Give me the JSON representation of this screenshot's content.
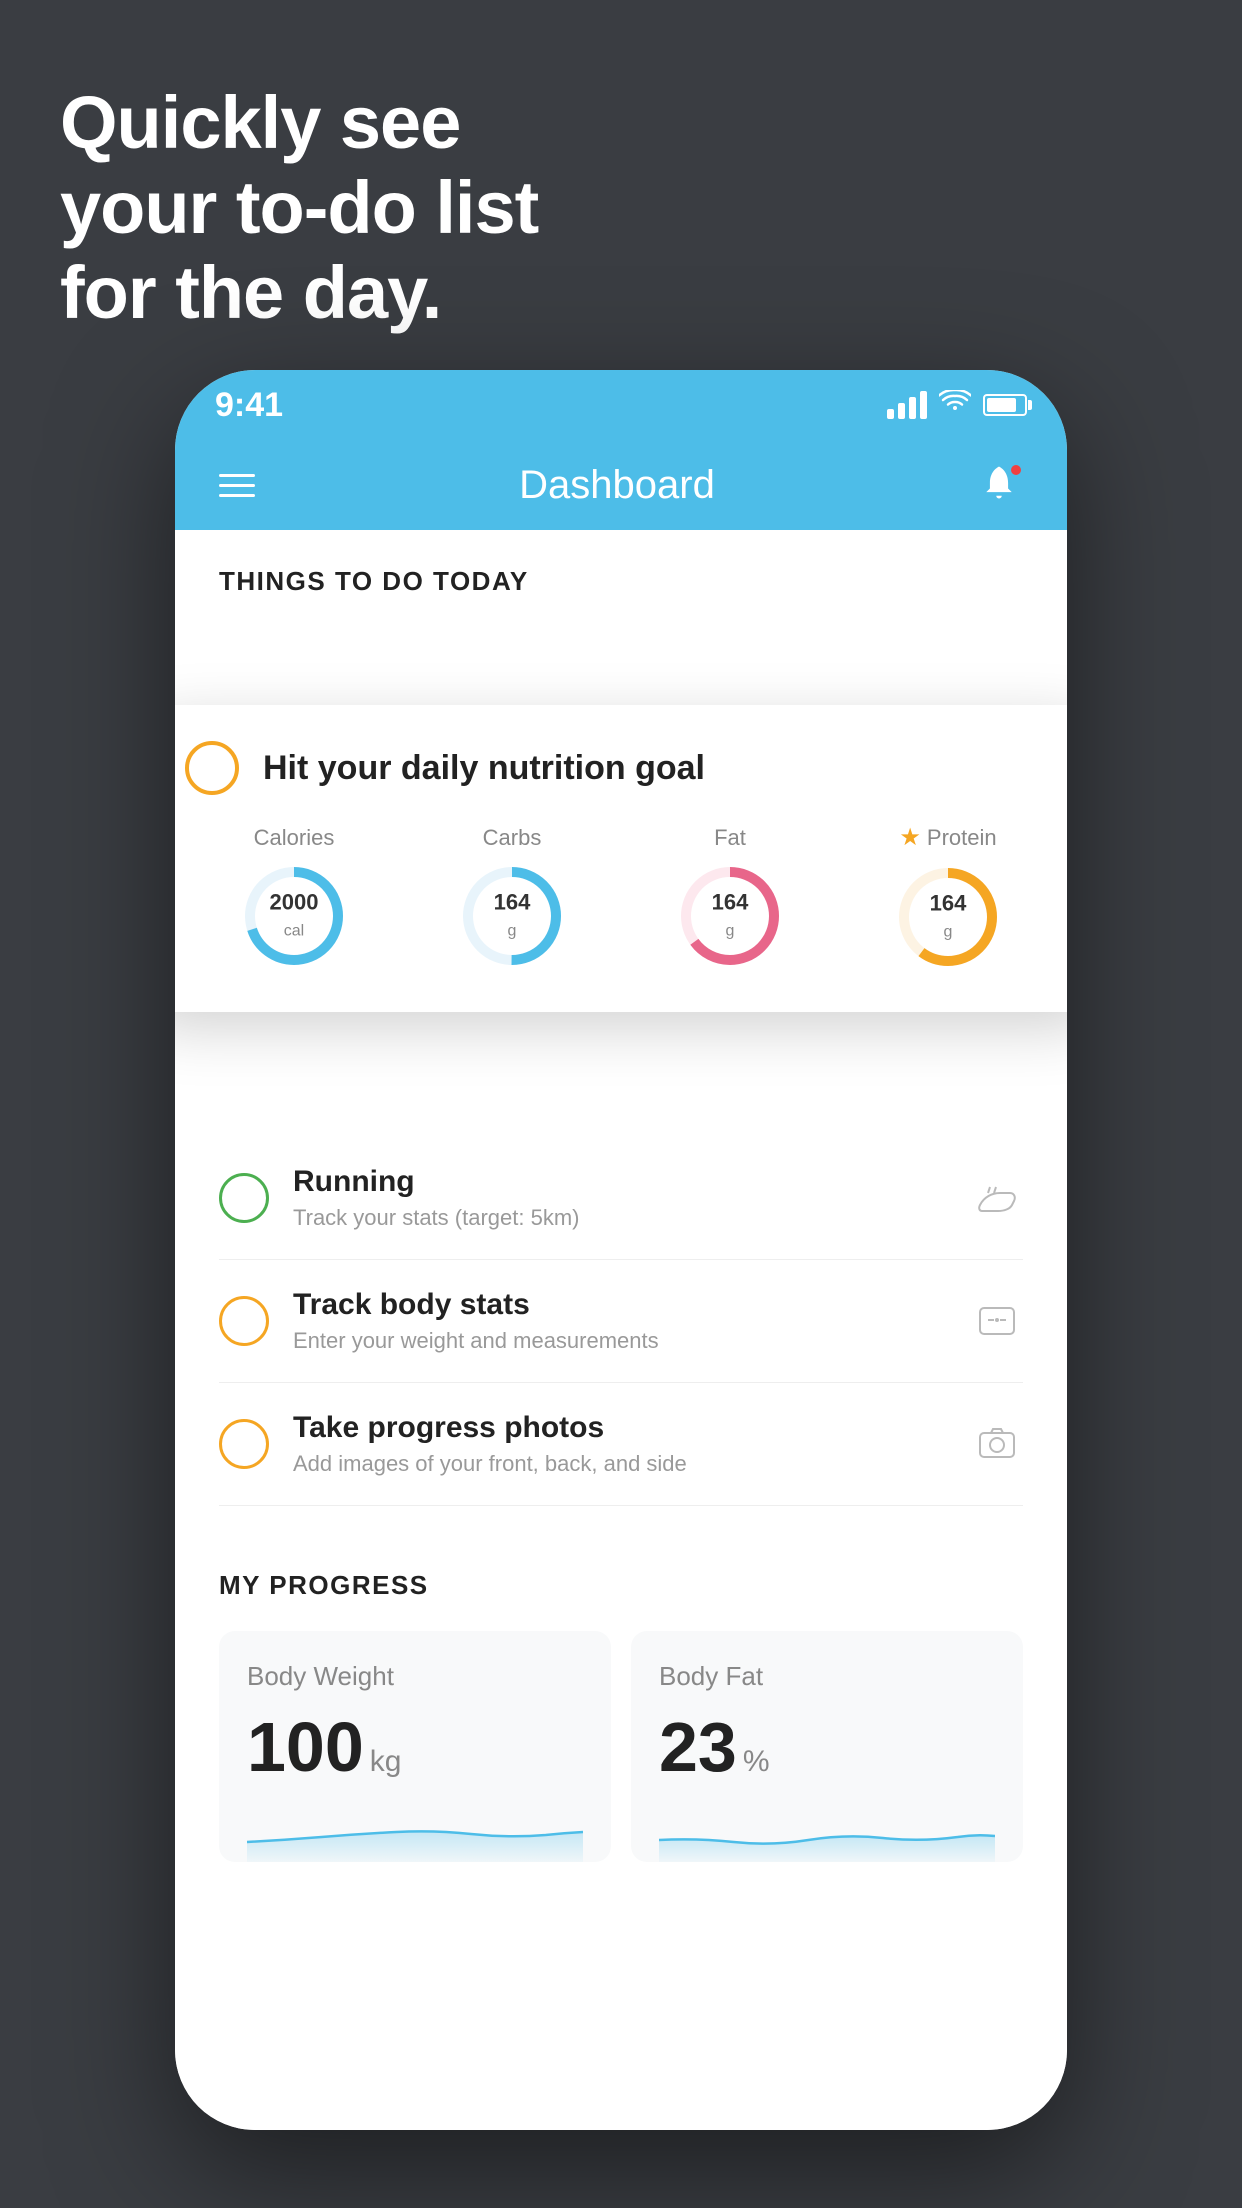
{
  "background": {
    "color": "#3a3d42"
  },
  "hero": {
    "line1": "Quickly see",
    "line2": "your to-do list",
    "line3": "for the day."
  },
  "phone": {
    "statusBar": {
      "time": "9:41",
      "signalBars": 4,
      "battery": "full"
    },
    "navBar": {
      "title": "Dashboard",
      "menuIcon": "hamburger-icon",
      "notificationIcon": "bell-icon"
    },
    "sectionHeader": "THINGS TO DO TODAY",
    "floatingCard": {
      "checkIcon": "circle-check-icon",
      "title": "Hit your daily nutrition goal",
      "nutrition": [
        {
          "label": "Calories",
          "value": "2000",
          "unit": "cal",
          "color": "#4dbde8",
          "starred": false,
          "progress": 0.7
        },
        {
          "label": "Carbs",
          "value": "164",
          "unit": "g",
          "color": "#4dbde8",
          "starred": false,
          "progress": 0.5
        },
        {
          "label": "Fat",
          "value": "164",
          "unit": "g",
          "color": "#e8668a",
          "starred": false,
          "progress": 0.65
        },
        {
          "label": "Protein",
          "value": "164",
          "unit": "g",
          "color": "#f5a623",
          "starred": true,
          "progress": 0.6
        }
      ]
    },
    "todoItems": [
      {
        "id": "running",
        "circleColor": "green",
        "title": "Running",
        "subtitle": "Track your stats (target: 5km)",
        "icon": "shoe-icon"
      },
      {
        "id": "body-stats",
        "circleColor": "yellow",
        "title": "Track body stats",
        "subtitle": "Enter your weight and measurements",
        "icon": "scale-icon"
      },
      {
        "id": "progress-photos",
        "circleColor": "yellow",
        "title": "Take progress photos",
        "subtitle": "Add images of your front, back, and side",
        "icon": "photo-icon"
      }
    ],
    "progressSection": {
      "header": "MY PROGRESS",
      "cards": [
        {
          "title": "Body Weight",
          "value": "100",
          "unit": "kg"
        },
        {
          "title": "Body Fat",
          "value": "23",
          "unit": "%"
        }
      ]
    }
  }
}
